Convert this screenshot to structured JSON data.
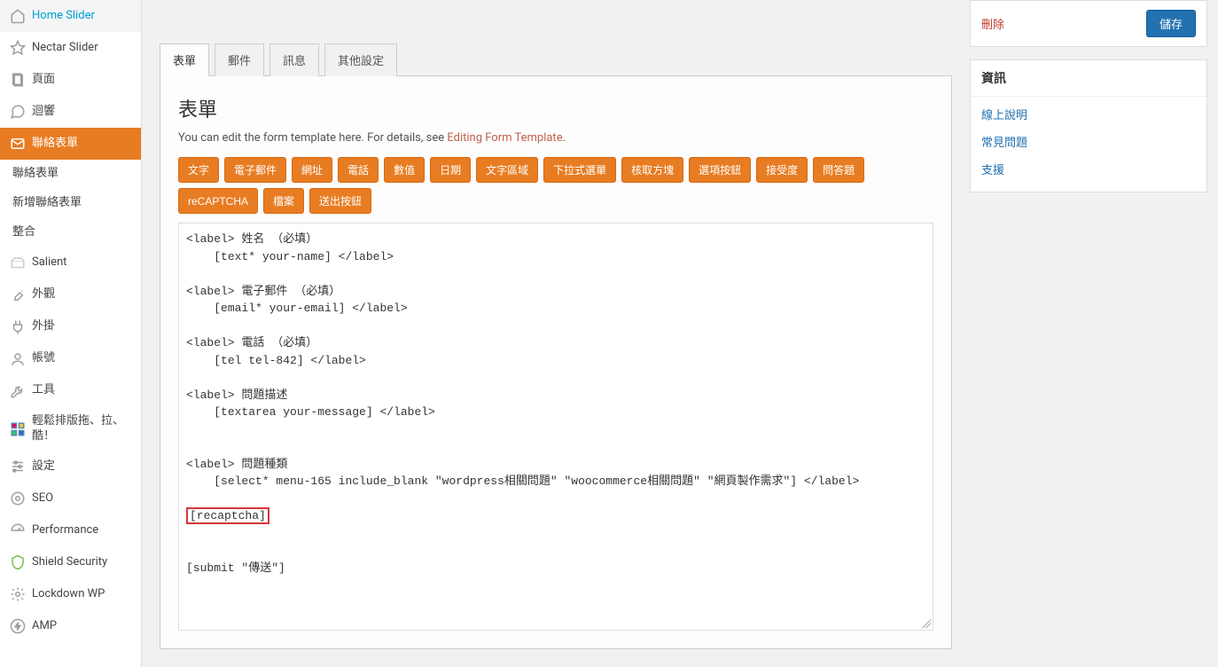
{
  "sidebar": {
    "items": [
      {
        "label": "Home Slider",
        "icon": "home"
      },
      {
        "label": "Nectar Slider",
        "icon": "star"
      },
      {
        "label": "頁面",
        "icon": "page"
      },
      {
        "label": "迴響",
        "icon": "comment"
      },
      {
        "label": "聯絡表單",
        "icon": "mail",
        "active": true
      }
    ],
    "sub": [
      {
        "label": "聯絡表單"
      },
      {
        "label": "新增聯絡表單"
      },
      {
        "label": "整合"
      }
    ],
    "items2": [
      {
        "label": "Salient",
        "icon": "salient"
      },
      {
        "label": "外觀",
        "icon": "brush"
      },
      {
        "label": "外掛",
        "icon": "plug"
      },
      {
        "label": "帳號",
        "icon": "user"
      },
      {
        "label": "工具",
        "icon": "wrench"
      },
      {
        "label": "輕鬆排版拖、拉、酷！",
        "icon": "layout"
      },
      {
        "label": "設定",
        "icon": "sliders"
      },
      {
        "label": "SEO",
        "icon": "seo"
      },
      {
        "label": "Performance",
        "icon": "gauge"
      },
      {
        "label": "Shield Security",
        "icon": "shield"
      },
      {
        "label": "Lockdown WP",
        "icon": "gear"
      },
      {
        "label": "AMP",
        "icon": "amp"
      }
    ]
  },
  "tabs": [
    {
      "label": "表單",
      "active": true
    },
    {
      "label": "郵件"
    },
    {
      "label": "訊息"
    },
    {
      "label": "其他設定"
    }
  ],
  "panel": {
    "title": "表單",
    "desc_prefix": "You can edit the form template here. For details, see ",
    "desc_link": "Editing Form Template",
    "desc_suffix": "."
  },
  "tag_buttons": [
    "文字",
    "電子郵件",
    "網址",
    "電話",
    "數值",
    "日期",
    "文字區域",
    "下拉式選單",
    "核取方塊",
    "選項按鈕",
    "接受度",
    "問答題",
    "reCAPTCHA",
    "檔案",
    "送出按鈕"
  ],
  "form_code_lines": [
    "<label> 姓名 （必填）",
    "    [text* your-name] </label>",
    "",
    "<label> 電子郵件 （必填）",
    "    [email* your-email] </label>",
    "",
    "<label> 電話 （必填）",
    "    [tel tel-842] </label>",
    "",
    "<label> 問題描述",
    "    [textarea your-message] </label>",
    "",
    "",
    "<label> 問題種類",
    "    [select* menu-165 include_blank \"wordpress相關問題\" \"woocommerce相關問題\" \"網頁製作需求\"] </label>",
    "",
    "[recaptcha]",
    "",
    "",
    "[submit \"傳送\"]"
  ],
  "highlight_line": "[recaptcha]",
  "right": {
    "delete": "刪除",
    "save": "儲存",
    "info_title": "資訊",
    "info_links": [
      "線上說明",
      "常見問題",
      "支援"
    ]
  }
}
